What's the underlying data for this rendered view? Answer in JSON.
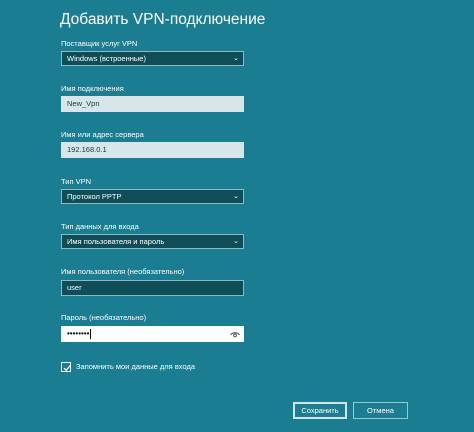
{
  "window": {
    "title": "Добавить VPN-подключение"
  },
  "form": {
    "provider": {
      "label": "Поставщик услуг VPN",
      "value": "Windows (встроенные)"
    },
    "connection_name": {
      "label": "Имя подключения",
      "value": "New_Vpn"
    },
    "server": {
      "label": "Имя или адрес сервера",
      "value": "192.168.0.1"
    },
    "vpn_type": {
      "label": "Тип VPN",
      "value": "Протокол PPTP"
    },
    "signin_type": {
      "label": "Тип данных для входа",
      "value": "Имя пользователя и пароль"
    },
    "username": {
      "label": "Имя пользователя (необязательно)",
      "value": "user"
    },
    "password": {
      "label": "Пароль (необязательно)",
      "value": "••••••••"
    },
    "remember": {
      "label": "Запомнить мои данные для входа",
      "checked": true
    }
  },
  "buttons": {
    "save_label": "Сохранить",
    "cancel_label": "Отмена"
  },
  "icons": {
    "dropdown": "chevron-down-icon",
    "reveal": "eye-icon",
    "check": "checkmark-icon"
  },
  "colors": {
    "background": "#1a7d91",
    "field_dark": "#0f4d59",
    "field_light": "#d8e6e9",
    "text": "#ffffff"
  }
}
